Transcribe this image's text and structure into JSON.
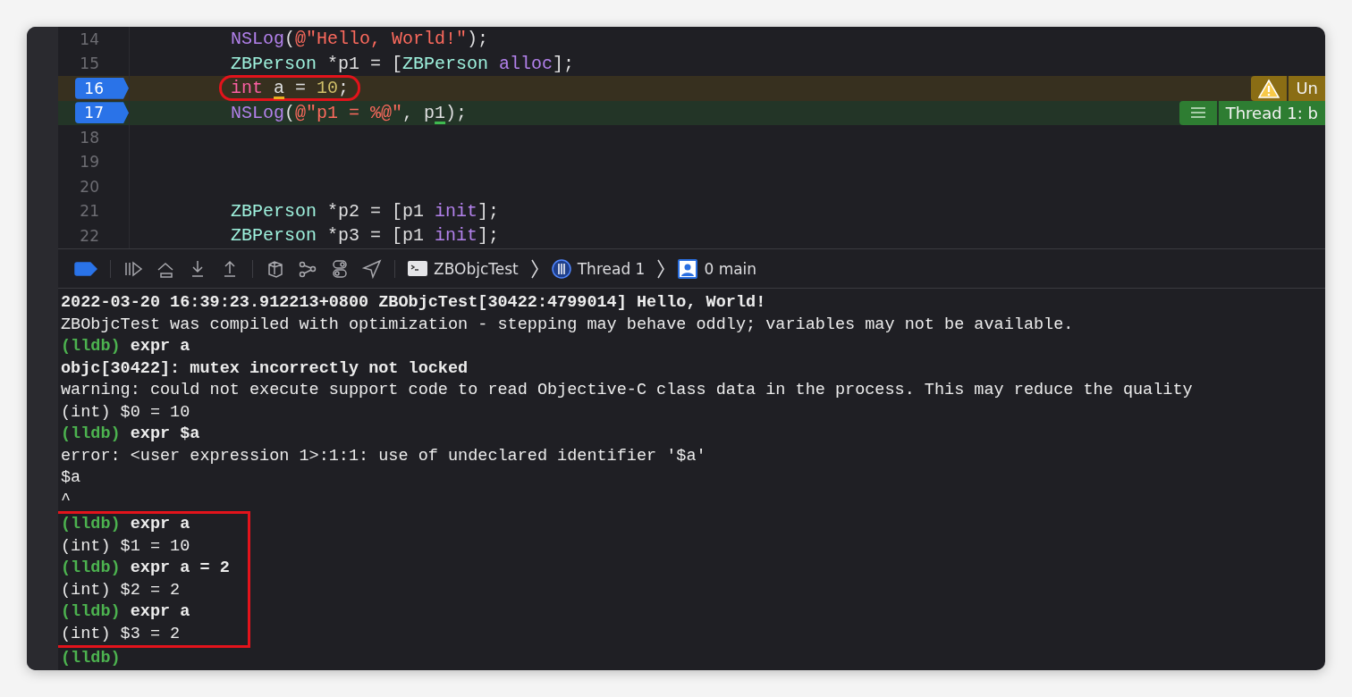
{
  "editor": {
    "lines": [
      {
        "number": "14",
        "breakpoint": false,
        "tokens": [
          {
            "t": "NSLog",
            "kind": "function"
          },
          {
            "t": "(",
            "kind": "plain"
          },
          {
            "t": "@\"Hello, World!\"",
            "kind": "string"
          },
          {
            "t": ");",
            "kind": "plain"
          }
        ]
      },
      {
        "number": "15",
        "breakpoint": false,
        "tokens": [
          {
            "t": "ZBPerson",
            "kind": "type"
          },
          {
            "t": " *p1 = [",
            "kind": "plain"
          },
          {
            "t": "ZBPerson",
            "kind": "type"
          },
          {
            "t": " alloc",
            "kind": "method"
          },
          {
            "t": "];",
            "kind": "plain"
          }
        ]
      },
      {
        "number": "16",
        "breakpoint": true,
        "circled": true,
        "tokens": [
          {
            "t": "int",
            "kind": "keyword"
          },
          {
            "t": " a",
            "kind": "plain",
            "underlined": true
          },
          {
            "t": " = ",
            "kind": "plain"
          },
          {
            "t": "10",
            "kind": "number"
          },
          {
            "t": ";",
            "kind": "plain"
          }
        ],
        "annotation": {
          "kind": "warning",
          "text": "Un"
        }
      },
      {
        "number": "17",
        "breakpoint": true,
        "tokens": [
          {
            "t": "NSLog",
            "kind": "function"
          },
          {
            "t": "(",
            "kind": "plain"
          },
          {
            "t": "@\"p1 = %@\"",
            "kind": "string"
          },
          {
            "t": ", p",
            "kind": "plain"
          },
          {
            "t": "1",
            "kind": "plain",
            "underlined": true
          },
          {
            "t": ");",
            "kind": "plain"
          }
        ],
        "annotation": {
          "kind": "thread",
          "text": "Thread 1: b"
        }
      },
      {
        "number": "18",
        "breakpoint": false
      },
      {
        "number": "19",
        "breakpoint": false
      },
      {
        "number": "20",
        "breakpoint": false
      },
      {
        "number": "21",
        "breakpoint": false,
        "tokens": [
          {
            "t": "ZBPerson",
            "kind": "type"
          },
          {
            "t": " *p2 = [p1 ",
            "kind": "plain"
          },
          {
            "t": "init",
            "kind": "method"
          },
          {
            "t": "];",
            "kind": "plain"
          }
        ]
      },
      {
        "number": "22",
        "breakpoint": false,
        "tokens": [
          {
            "t": "ZBPerson",
            "kind": "type"
          },
          {
            "t": " *p3 = [p1 ",
            "kind": "plain"
          },
          {
            "t": "init",
            "kind": "method"
          },
          {
            "t": "];",
            "kind": "plain"
          }
        ]
      }
    ]
  },
  "debug_bar": {
    "breakpoints_active": true,
    "breadcrumbs": [
      {
        "kind": "process",
        "label": "ZBObjcTest"
      },
      {
        "kind": "thread",
        "label": "Thread 1"
      },
      {
        "kind": "frame",
        "label": "0 main"
      }
    ]
  },
  "console": {
    "lines": [
      {
        "text": "2022-03-20 16:39:23.912213+0800 ZBObjcTest[30422:4799014] Hello, World!",
        "bold": true
      },
      {
        "text": "ZBObjcTest was compiled with optimization - stepping may behave oddly; variables may not be available.",
        "bold": false
      },
      {
        "prompt": "(lldb)",
        "text": "expr a",
        "bold": true
      },
      {
        "text": "objc[30422]: mutex incorrectly not locked",
        "bold": true
      },
      {
        "text": "warning: could not execute support code to read Objective-C class data in the process. This may reduce the quality",
        "bold": false
      },
      {
        "text": "(int) $0 = 10",
        "bold": false
      },
      {
        "prompt": "(lldb)",
        "text": "expr $a",
        "bold": true
      },
      {
        "text": "error: <user expression 1>:1:1: use of undeclared identifier '$a'",
        "bold": false
      },
      {
        "text": "$a",
        "bold": false
      },
      {
        "text": "^",
        "bold": false
      }
    ],
    "boxed_lines": [
      {
        "prompt": "(lldb)",
        "text": "expr a",
        "bold": true
      },
      {
        "text": "(int) $1 = 10",
        "bold": false
      },
      {
        "prompt": "(lldb)",
        "text": "expr a = 2",
        "bold": true
      },
      {
        "text": "(int) $2 = 2",
        "bold": false
      },
      {
        "prompt": "(lldb)",
        "text": "expr a",
        "bold": true
      },
      {
        "text": "(int) $3 = 2",
        "bold": false
      }
    ],
    "trailing_lines": [
      {
        "prompt": "(lldb)"
      }
    ]
  }
}
